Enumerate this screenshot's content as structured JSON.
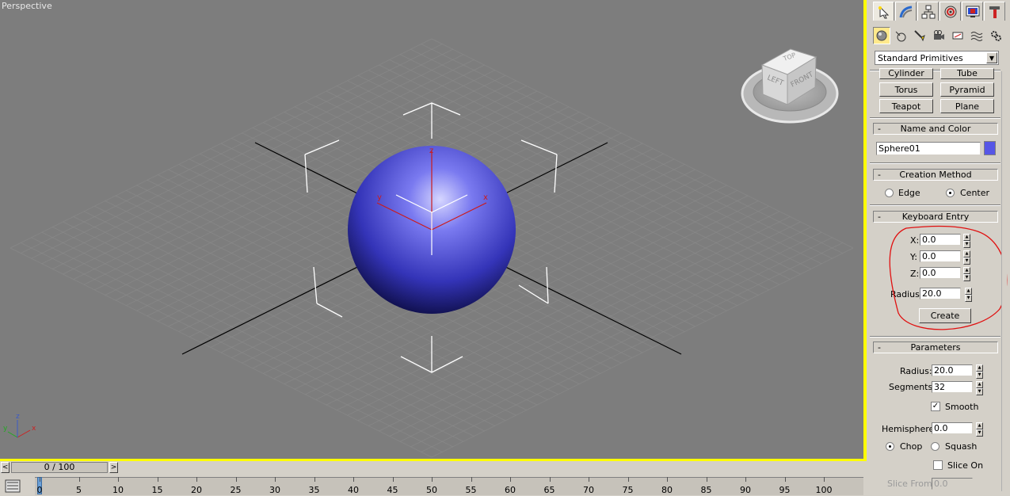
{
  "viewport": {
    "label": "Perspective",
    "viewcube": {
      "top": "TOP",
      "left": "LEFT",
      "front": "FRONT"
    },
    "gizmo_axes": {
      "x": "x",
      "y": "y",
      "z": "z"
    },
    "sphere_color": "#5656e6"
  },
  "panel": {
    "tabs": [
      "create-icon",
      "modify-icon",
      "hierarchy-icon",
      "motion-icon",
      "display-icon",
      "utilities-icon"
    ],
    "subcategories": [
      "geometry-icon",
      "shapes-icon",
      "lights-icon",
      "cameras-icon",
      "helpers-icon",
      "spacewarps-icon",
      "systems-icon"
    ],
    "category_dropdown": "Standard Primitives",
    "object_types": [
      "Cylinder",
      "Tube",
      "Torus",
      "Pyramid",
      "Teapot",
      "Plane"
    ],
    "name_and_color": {
      "title": "Name and Color",
      "name": "Sphere01",
      "color": "#5656e6"
    },
    "creation_method": {
      "title": "Creation Method",
      "edge": "Edge",
      "center": "Center",
      "selected": "Center"
    },
    "keyboard_entry": {
      "title": "Keyboard Entry",
      "x_label": "X:",
      "x": "0.0",
      "y_label": "Y:",
      "y": "0.0",
      "z_label": "Z:",
      "z": "0.0",
      "radius_label": "Radius:",
      "radius": "20.0",
      "create_label": "Create",
      "annotation_color": "#e01010"
    },
    "parameters": {
      "title": "Parameters",
      "radius_label": "Radius:",
      "radius": "20.0",
      "segments_label": "Segments:",
      "segments": "32",
      "smooth_label": "Smooth",
      "smooth": true,
      "hemisphere_label": "Hemisphere:",
      "hemisphere": "0.0",
      "chop_label": "Chop",
      "squash_label": "Squash",
      "selected": "Chop",
      "slice_on_label": "Slice On",
      "slice_on": false,
      "slice_from_label": "Slice From:",
      "slice_from": "0.0"
    }
  },
  "timeline": {
    "slider_text": "0 / 100",
    "prev": "<",
    "next": ">",
    "ticks": [
      "0",
      "5",
      "10",
      "15",
      "20",
      "25",
      "30",
      "35",
      "40",
      "45",
      "50",
      "55",
      "60",
      "65",
      "70",
      "75",
      "80",
      "85",
      "90",
      "95",
      "100"
    ]
  }
}
